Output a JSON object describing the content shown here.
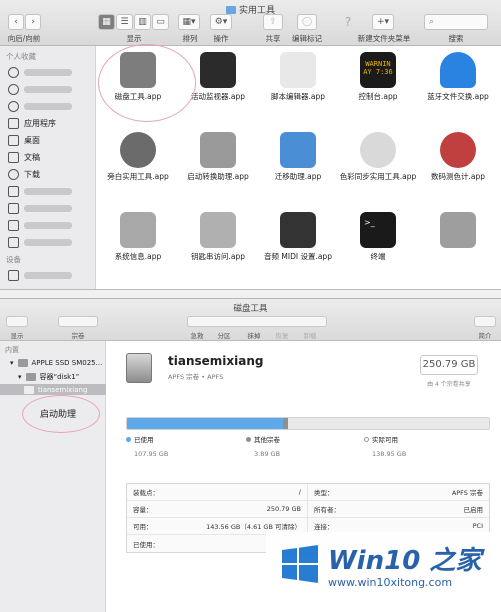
{
  "finder": {
    "title": "实用工具",
    "toolbar": {
      "nav_label": "向后/向前",
      "view_label": "显示",
      "arrange_label": "排列",
      "action_label": "操作",
      "share_label": "共享",
      "tags_label": "编辑标记",
      "new_folder_label": "新建文件夹菜单",
      "search_label": "搜索"
    },
    "sidebar": {
      "favorites_header": "个人收藏",
      "items": [
        {
          "label": "",
          "icon": "airdrop-icon"
        },
        {
          "label": "",
          "icon": "icloud-icon"
        },
        {
          "label": "",
          "icon": "icloud-icon"
        },
        {
          "label": "应用程序",
          "icon": "applications-icon"
        },
        {
          "label": "桌面",
          "icon": "desktop-icon"
        },
        {
          "label": "文稿",
          "icon": "documents-icon"
        },
        {
          "label": "下载",
          "icon": "downloads-icon"
        },
        {
          "label": "",
          "icon": "folder-icon"
        },
        {
          "label": "",
          "icon": "folder-icon"
        },
        {
          "label": "",
          "icon": "folder-icon"
        },
        {
          "label": "",
          "icon": "music-icon"
        }
      ],
      "devices_header": "设备"
    },
    "apps": [
      {
        "label": "磁盘工具.app",
        "icon": "disk-utility-icon",
        "color": "#7d7d7d"
      },
      {
        "label": "活动监视器.app",
        "icon": "activity-monitor-icon",
        "color": "#2b2b2b"
      },
      {
        "label": "脚本编辑器.app",
        "icon": "script-editor-icon",
        "color": "#e8e8e8"
      },
      {
        "label": "控制台.app",
        "icon": "console-icon",
        "color": "#1b1b1b"
      },
      {
        "label": "蓝牙文件交换.app",
        "icon": "bluetooth-icon",
        "color": "#2a83e0"
      },
      {
        "label": "旁白实用工具.app",
        "icon": "voiceover-icon",
        "color": "#6b6b6b"
      },
      {
        "label": "启动转换助理.app",
        "icon": "boot-camp-icon",
        "color": "#9a9a9a"
      },
      {
        "label": "迁移助理.app",
        "icon": "migration-assistant-icon",
        "color": "#4a8fd6"
      },
      {
        "label": "色彩同步实用工具.app",
        "icon": "colorsync-icon",
        "color": "#d9d9d9"
      },
      {
        "label": "数码测色计.app",
        "icon": "digital-color-meter-icon",
        "color": "#c04040"
      },
      {
        "label": "系统信息.app",
        "icon": "system-information-icon",
        "color": "#a8a8a8"
      },
      {
        "label": "钥匙串访问.app",
        "icon": "keychain-icon",
        "color": "#b0b0b0"
      },
      {
        "label": "音频 MIDI 设置.app",
        "icon": "audio-midi-icon",
        "color": "#333333"
      },
      {
        "label": "终端",
        "icon": "terminal-icon",
        "color": "#1a1a1a"
      },
      {
        "label": "",
        "icon": "grapher-icon",
        "color": "#9e9e9e"
      }
    ],
    "console_text": "WARNIN\nAY 7:36"
  },
  "disk_utility": {
    "title": "磁盘工具",
    "toolbar": {
      "view_label": "显示",
      "volume_label": "宗卷",
      "first_aid_label": "急救",
      "partition_label": "分区",
      "erase_label": "抹掉",
      "restore_label": "恢复",
      "unmount_label": "卸载",
      "info_label": "简介"
    },
    "sidebar": {
      "header": "内置",
      "disk": "APPLE SSD SM025...",
      "container": "容器“disk1”",
      "volume": "tiansemixiang"
    },
    "volume": {
      "name": "tiansemixiang",
      "subtitle": "APFS 宗卷 • APFS",
      "size": "250.79 GB",
      "size_note": "由 4 个宗卷共享"
    },
    "usage": {
      "used_fraction": 0.43,
      "other_fraction": 0.016,
      "used_label": "已使用",
      "used_value": "107.95 GB",
      "used_color": "#5ea9ea",
      "other_label": "其他宗卷",
      "other_value": "3.89 GB",
      "other_color": "#8f8f8f",
      "free_label": "实际可用",
      "free_value": "138.95 GB"
    },
    "info": [
      {
        "k1": "装载点：",
        "v1": "/",
        "k2": "类型：",
        "v2": "APFS 宗卷"
      },
      {
        "k1": "容量：",
        "v1": "250.79 GB",
        "k2": "所有者：",
        "v2": "已启用"
      },
      {
        "k1": "可用：",
        "v1": "143.56 GB（4.61 GB 可清除）",
        "k2": "连接：",
        "v2": "PCI"
      },
      {
        "k1": "已使用：",
        "v1": "",
        "k2": "",
        "v2": ""
      }
    ],
    "note": "启动助理"
  },
  "watermark": {
    "brand": "Win10 之家",
    "url": "www.win10xitong.com"
  }
}
